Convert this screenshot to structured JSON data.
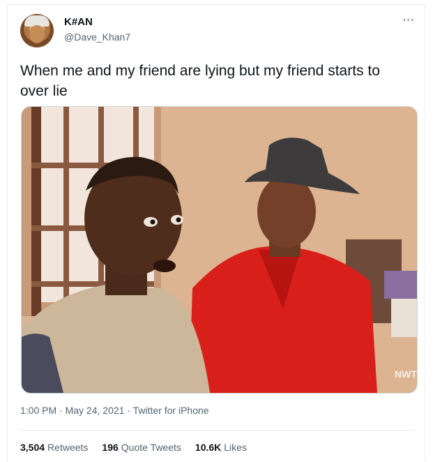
{
  "user": {
    "display_name": "K#AN",
    "handle": "@Dave_Khan7"
  },
  "more_icon": "more-options-icon",
  "tweet": {
    "text": "When me and my friend are lying but my friend starts to over lie"
  },
  "media": {
    "watermark": "NWT"
  },
  "meta": {
    "time": "1:00 PM",
    "sep1": " · ",
    "date": "May 24, 2021",
    "sep2": " · ",
    "source": "Twitter for iPhone"
  },
  "stats": [
    {
      "count": "3,504",
      "label": "Retweets"
    },
    {
      "count": "196",
      "label": "Quote Tweets"
    },
    {
      "count": "10.6K",
      "label": "Likes"
    }
  ]
}
